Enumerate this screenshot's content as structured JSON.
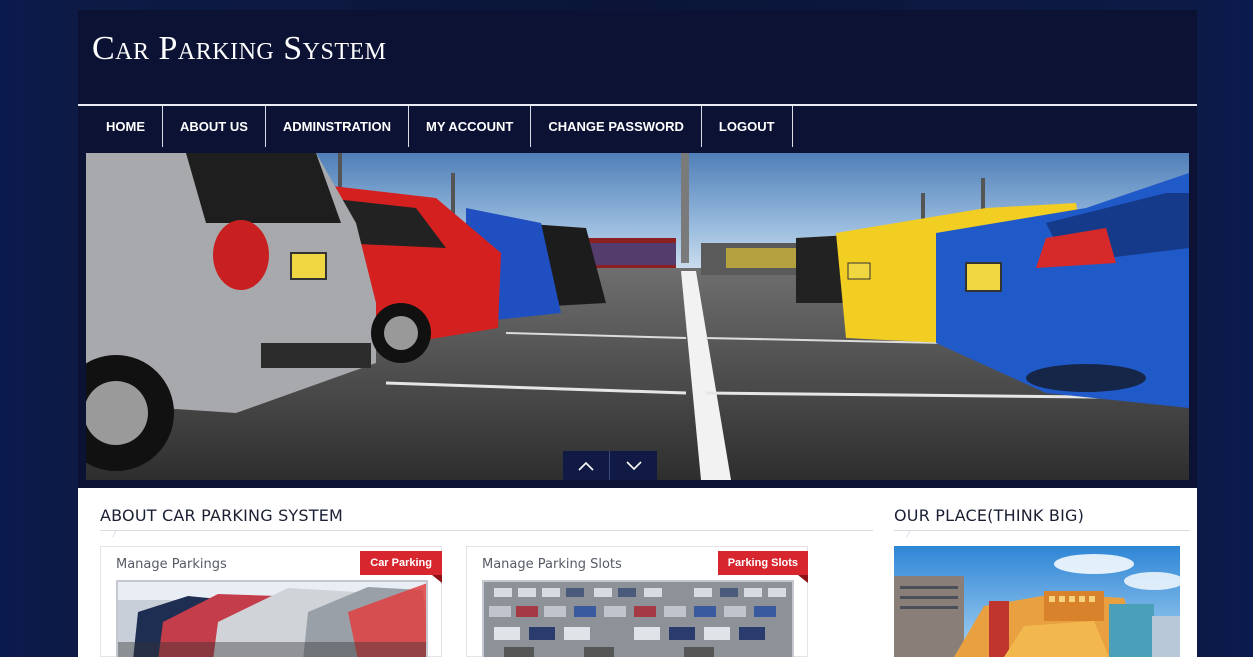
{
  "site": {
    "title": "Car Parking System"
  },
  "nav": {
    "items": [
      {
        "label": "HOME"
      },
      {
        "label": "ABOUT US"
      },
      {
        "label": "ADMINSTRATION"
      },
      {
        "label": "MY ACCOUNT"
      },
      {
        "label": "CHANGE PASSWORD"
      },
      {
        "label": "LOGOUT"
      }
    ]
  },
  "banner": {
    "prev_icon": "chevron-up-icon",
    "next_icon": "chevron-down-icon"
  },
  "about": {
    "heading": "ABOUT CAR PARKING SYSTEM",
    "cards": [
      {
        "title": "Manage Parkings",
        "badge": "Car Parking"
      },
      {
        "title": "Manage Parking Slots",
        "badge": "Parking Slots"
      }
    ]
  },
  "place": {
    "heading": "OUR PLACE(THINK BIG)"
  },
  "colors": {
    "navy": "#0c1234",
    "accent_red": "#d8262e",
    "white": "#ffffff"
  }
}
